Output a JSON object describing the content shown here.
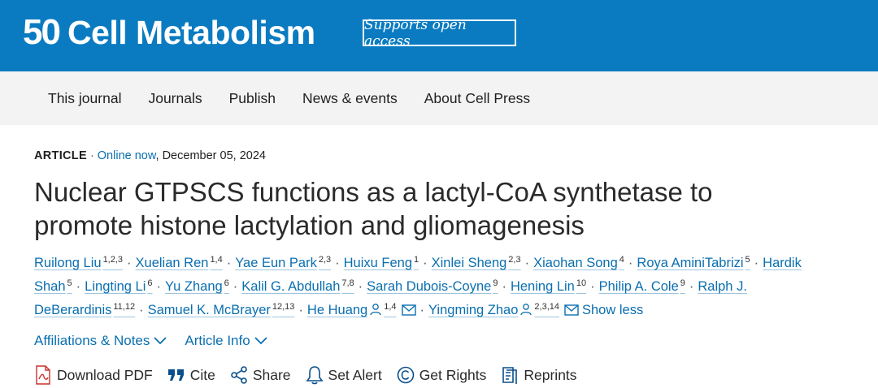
{
  "header": {
    "logo_mark": "50",
    "journal_name": "Cell Metabolism",
    "badge": "Supports open access",
    "brand_color": "#0a7bc1"
  },
  "nav": {
    "items": [
      "This journal",
      "Journals",
      "Publish",
      "News & events",
      "About Cell Press"
    ]
  },
  "article": {
    "type": "ARTICLE",
    "status": "Online now",
    "date": ", December 05, 2024",
    "title": "Nuclear GTPSCS functions as a lactyl-CoA synthetase to promote histone lactylation and gliomagenesis"
  },
  "authors": [
    {
      "name": "Ruilong Liu",
      "aff": "1,2,3"
    },
    {
      "name": "Xuelian Ren",
      "aff": "1,4"
    },
    {
      "name": "Yae Eun Park",
      "aff": "2,3"
    },
    {
      "name": "Huixu Feng",
      "aff": "1"
    },
    {
      "name": "Xinlei Sheng",
      "aff": "2,3"
    },
    {
      "name": "Xiaohan Song",
      "aff": "4"
    },
    {
      "name": "Roya AminiTabrizi",
      "aff": "5"
    },
    {
      "name": "Hardik Shah",
      "aff": "5"
    },
    {
      "name": "Lingting Li",
      "aff": "6"
    },
    {
      "name": "Yu Zhang",
      "aff": "6"
    },
    {
      "name": "Kalil G. Abdullah",
      "aff": "7,8"
    },
    {
      "name": "Sarah Dubois-Coyne",
      "aff": "9"
    },
    {
      "name": "Hening Lin",
      "aff": "10"
    },
    {
      "name": "Philip A. Cole",
      "aff": "9"
    },
    {
      "name": "Ralph J. DeBerardinis",
      "aff": "11,12"
    },
    {
      "name": "Samuel K. McBrayer",
      "aff": "12,13"
    },
    {
      "name": "He Huang",
      "aff": "1,4",
      "corresponding": true
    },
    {
      "name": "Yingming Zhao",
      "aff": "2,3,14",
      "corresponding": true
    }
  ],
  "show_less": "Show less",
  "info_links": {
    "affiliations": "Affiliations & Notes",
    "article_info": "Article Info"
  },
  "tools": {
    "download_pdf": "Download PDF",
    "cite": "Cite",
    "share": "Share",
    "set_alert": "Set Alert",
    "get_rights": "Get Rights",
    "reprints": "Reprints"
  }
}
